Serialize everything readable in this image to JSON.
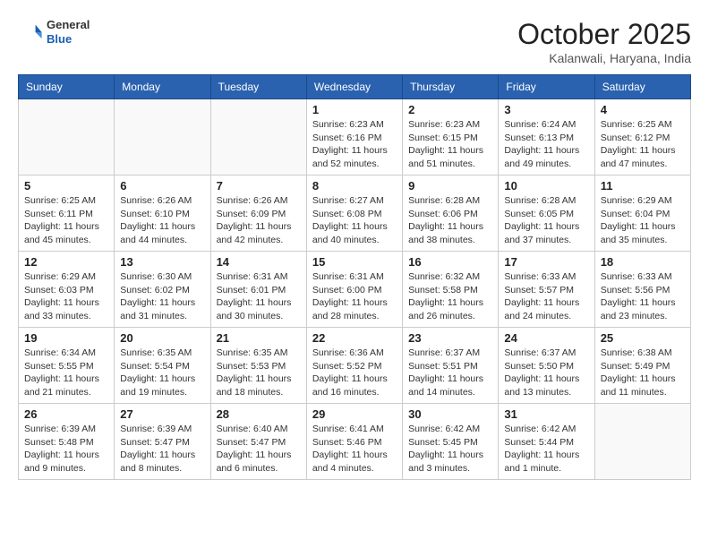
{
  "header": {
    "logo_general": "General",
    "logo_blue": "Blue",
    "month_title": "October 2025",
    "subtitle": "Kalanwali, Haryana, India"
  },
  "days_of_week": [
    "Sunday",
    "Monday",
    "Tuesday",
    "Wednesday",
    "Thursday",
    "Friday",
    "Saturday"
  ],
  "weeks": [
    [
      {
        "day": "",
        "info": ""
      },
      {
        "day": "",
        "info": ""
      },
      {
        "day": "",
        "info": ""
      },
      {
        "day": "1",
        "info": "Sunrise: 6:23 AM\nSunset: 6:16 PM\nDaylight: 11 hours\nand 52 minutes."
      },
      {
        "day": "2",
        "info": "Sunrise: 6:23 AM\nSunset: 6:15 PM\nDaylight: 11 hours\nand 51 minutes."
      },
      {
        "day": "3",
        "info": "Sunrise: 6:24 AM\nSunset: 6:13 PM\nDaylight: 11 hours\nand 49 minutes."
      },
      {
        "day": "4",
        "info": "Sunrise: 6:25 AM\nSunset: 6:12 PM\nDaylight: 11 hours\nand 47 minutes."
      }
    ],
    [
      {
        "day": "5",
        "info": "Sunrise: 6:25 AM\nSunset: 6:11 PM\nDaylight: 11 hours\nand 45 minutes."
      },
      {
        "day": "6",
        "info": "Sunrise: 6:26 AM\nSunset: 6:10 PM\nDaylight: 11 hours\nand 44 minutes."
      },
      {
        "day": "7",
        "info": "Sunrise: 6:26 AM\nSunset: 6:09 PM\nDaylight: 11 hours\nand 42 minutes."
      },
      {
        "day": "8",
        "info": "Sunrise: 6:27 AM\nSunset: 6:08 PM\nDaylight: 11 hours\nand 40 minutes."
      },
      {
        "day": "9",
        "info": "Sunrise: 6:28 AM\nSunset: 6:06 PM\nDaylight: 11 hours\nand 38 minutes."
      },
      {
        "day": "10",
        "info": "Sunrise: 6:28 AM\nSunset: 6:05 PM\nDaylight: 11 hours\nand 37 minutes."
      },
      {
        "day": "11",
        "info": "Sunrise: 6:29 AM\nSunset: 6:04 PM\nDaylight: 11 hours\nand 35 minutes."
      }
    ],
    [
      {
        "day": "12",
        "info": "Sunrise: 6:29 AM\nSunset: 6:03 PM\nDaylight: 11 hours\nand 33 minutes."
      },
      {
        "day": "13",
        "info": "Sunrise: 6:30 AM\nSunset: 6:02 PM\nDaylight: 11 hours\nand 31 minutes."
      },
      {
        "day": "14",
        "info": "Sunrise: 6:31 AM\nSunset: 6:01 PM\nDaylight: 11 hours\nand 30 minutes."
      },
      {
        "day": "15",
        "info": "Sunrise: 6:31 AM\nSunset: 6:00 PM\nDaylight: 11 hours\nand 28 minutes."
      },
      {
        "day": "16",
        "info": "Sunrise: 6:32 AM\nSunset: 5:58 PM\nDaylight: 11 hours\nand 26 minutes."
      },
      {
        "day": "17",
        "info": "Sunrise: 6:33 AM\nSunset: 5:57 PM\nDaylight: 11 hours\nand 24 minutes."
      },
      {
        "day": "18",
        "info": "Sunrise: 6:33 AM\nSunset: 5:56 PM\nDaylight: 11 hours\nand 23 minutes."
      }
    ],
    [
      {
        "day": "19",
        "info": "Sunrise: 6:34 AM\nSunset: 5:55 PM\nDaylight: 11 hours\nand 21 minutes."
      },
      {
        "day": "20",
        "info": "Sunrise: 6:35 AM\nSunset: 5:54 PM\nDaylight: 11 hours\nand 19 minutes."
      },
      {
        "day": "21",
        "info": "Sunrise: 6:35 AM\nSunset: 5:53 PM\nDaylight: 11 hours\nand 18 minutes."
      },
      {
        "day": "22",
        "info": "Sunrise: 6:36 AM\nSunset: 5:52 PM\nDaylight: 11 hours\nand 16 minutes."
      },
      {
        "day": "23",
        "info": "Sunrise: 6:37 AM\nSunset: 5:51 PM\nDaylight: 11 hours\nand 14 minutes."
      },
      {
        "day": "24",
        "info": "Sunrise: 6:37 AM\nSunset: 5:50 PM\nDaylight: 11 hours\nand 13 minutes."
      },
      {
        "day": "25",
        "info": "Sunrise: 6:38 AM\nSunset: 5:49 PM\nDaylight: 11 hours\nand 11 minutes."
      }
    ],
    [
      {
        "day": "26",
        "info": "Sunrise: 6:39 AM\nSunset: 5:48 PM\nDaylight: 11 hours\nand 9 minutes."
      },
      {
        "day": "27",
        "info": "Sunrise: 6:39 AM\nSunset: 5:47 PM\nDaylight: 11 hours\nand 8 minutes."
      },
      {
        "day": "28",
        "info": "Sunrise: 6:40 AM\nSunset: 5:47 PM\nDaylight: 11 hours\nand 6 minutes."
      },
      {
        "day": "29",
        "info": "Sunrise: 6:41 AM\nSunset: 5:46 PM\nDaylight: 11 hours\nand 4 minutes."
      },
      {
        "day": "30",
        "info": "Sunrise: 6:42 AM\nSunset: 5:45 PM\nDaylight: 11 hours\nand 3 minutes."
      },
      {
        "day": "31",
        "info": "Sunrise: 6:42 AM\nSunset: 5:44 PM\nDaylight: 11 hours\nand 1 minute."
      },
      {
        "day": "",
        "info": ""
      }
    ]
  ]
}
